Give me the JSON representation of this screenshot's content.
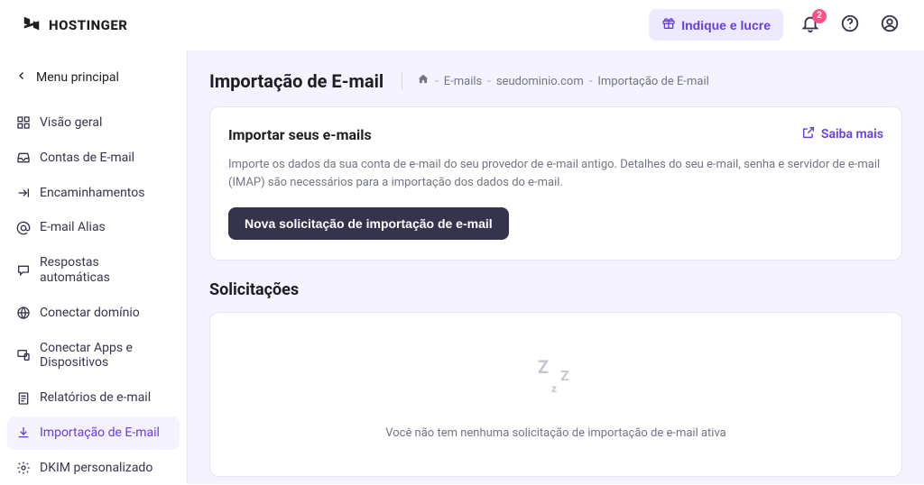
{
  "header": {
    "brand": "HOSTINGER",
    "refer_label": "Indique e lucre",
    "notification_count": "2"
  },
  "sidebar": {
    "back_label": "Menu principal",
    "items": [
      {
        "label": "Visão geral"
      },
      {
        "label": "Contas de E-mail"
      },
      {
        "label": "Encaminhamentos"
      },
      {
        "label": "E-mail Alias"
      },
      {
        "label": "Respostas automáticas"
      },
      {
        "label": "Conectar domínio"
      },
      {
        "label": "Conectar Apps e Dispositivos"
      },
      {
        "label": "Relatórios de e-mail"
      },
      {
        "label": "Importação de E-mail"
      },
      {
        "label": "DKIM personalizado"
      }
    ]
  },
  "page": {
    "title": "Importação de E-mail",
    "breadcrumb": {
      "seg1": "E-mails",
      "seg2": "seudominio.com",
      "seg3": "Importação de E-mail"
    }
  },
  "card_import": {
    "title": "Importar seus e-mails",
    "learn_more": "Saiba mais",
    "description": "Importe os dados da sua conta de e-mail do seu provedor de e-mail antigo. Detalhes do seu e-mail, senha e servidor de e-mail (IMAP) são necessários para a importação dos dados do e-mail.",
    "button": "Nova solicitação de importação de e-mail"
  },
  "section_requests": {
    "title": "Solicitações",
    "empty_text": "Você não tem nenhuma solicitação de importação de e-mail ativa"
  }
}
